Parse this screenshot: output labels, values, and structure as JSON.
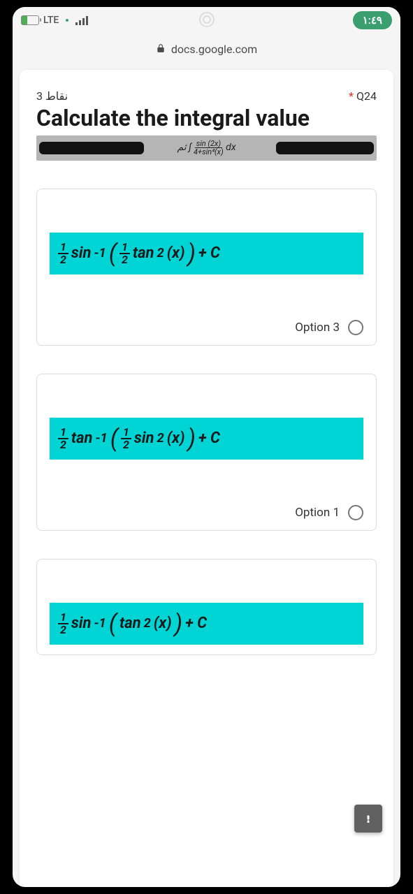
{
  "status": {
    "carrier": "LTE",
    "time": "١:٤٩"
  },
  "urlbar": {
    "host": "docs.google.com"
  },
  "question": {
    "points": "3 نقاط",
    "label": "Q24",
    "required_mark": "*",
    "title": "Calculate the integral value",
    "integral_prefix": "ثم ∫",
    "integral_num": "sin (2x)",
    "integral_den": "4+sin⁴(x)",
    "integral_dx": "dx"
  },
  "options": [
    {
      "fn": "sin",
      "inv": "-1",
      "inner_fn": "tan",
      "inner_pow": "2",
      "arg": "(x)",
      "tail": "+ C",
      "label": "Option 3"
    },
    {
      "fn": "tan",
      "inv": "-1",
      "inner_fn": "sin",
      "inner_pow": "2",
      "arg": "(x)",
      "tail": "+ C",
      "label": "Option 1"
    },
    {
      "fn": "sin",
      "inv": "-1",
      "inner_fn": "tan",
      "inner_pow": "2",
      "arg": "(x)",
      "tail": "+ C",
      "label": ""
    }
  ],
  "frac": {
    "one": "1",
    "two": "2"
  }
}
